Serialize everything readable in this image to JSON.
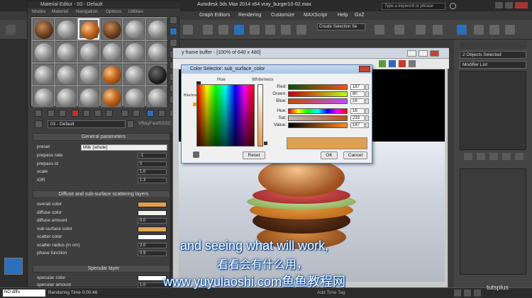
{
  "max": {
    "title": "Autodesk 3ds Max  2014 x64      vray_burger10-02.max",
    "search_placeholder": "Type a keyword or phrase",
    "menu": [
      "Graph Editors",
      "Rendering",
      "Customize",
      "MAXScript",
      "Help",
      "GoZ"
    ],
    "selection_set": "Create Selection Se"
  },
  "material_editor": {
    "title": "Material Editor - 03 - Default",
    "menu": [
      "Modes",
      "Material",
      "Navigation",
      "Options",
      "Utilities"
    ],
    "material_name": "03 - Default",
    "material_type": "VRayFastSSS2",
    "general": {
      "header": "General parameters",
      "preset_label": "preset",
      "preset_value": "Milk (whole)",
      "prepass_rate_label": "prepass rate",
      "prepass_rate": "-1",
      "prepass_id_label": "prepass id",
      "prepass_id": "0",
      "scale_label": "scale",
      "scale": "1.0",
      "ior_label": "IOR",
      "ior": "1.3"
    },
    "diffuse_sss": {
      "header": "Diffuse and sub-surface scattering layers",
      "overall_color_label": "overall color",
      "diffuse_color_label": "diffuse color",
      "diffuse_amount_label": "diffuse amount",
      "diffuse_amount": "0.0",
      "sub_surface_color_label": "sub-surface color",
      "scatter_color_label": "scatter color",
      "scatter_radius_label": "scatter radius (in cm)",
      "scatter_radius": "2.0",
      "phase_function_label": "phase function",
      "phase_function": "0.9"
    },
    "specular": {
      "header": "Specular layer",
      "specular_color_label": "specular color",
      "specular_amount_label": "specular amount",
      "specular_amount": "1.0"
    }
  },
  "vfb": {
    "title": "V-Ray frame buffer - [100% of 640 x 480]",
    "visible_title": "y frame buffer - [100% of 640 x 480]"
  },
  "color_selector": {
    "title": "Color Selector: sub_surface_color",
    "hue_label": "Hue",
    "whiteness_label": "Whiteness",
    "blackness_label": "Blackness",
    "rows": [
      {
        "label": "Red:",
        "value": "187"
      },
      {
        "label": "Green:",
        "value": "80"
      },
      {
        "label": "Blue:",
        "value": "16"
      },
      {
        "label": "Hue:",
        "value": "16"
      },
      {
        "label": "Sat:",
        "value": "233"
      },
      {
        "label": "Value:",
        "value": "187"
      }
    ],
    "reset_label": "Reset",
    "ok_label": "OK",
    "cancel_label": "Cancel"
  },
  "command_panel": {
    "selection": "2 Objects Selected",
    "modifier_list": "Modifier List"
  },
  "status": {
    "left": "NO diffu",
    "rendering_time": "Rendering Time  0:00:46",
    "add_time_tag": "Add Time Tag"
  },
  "subtitles": {
    "english": "and seeing what will work,",
    "chinese": "看看会有什么用，",
    "url": "www.yuyulaoshi.com鱼鱼教程网"
  },
  "watermark": "tutsplus",
  "colors": {
    "overall": "#e0a04f",
    "diffuse": "#f4f4ee",
    "sub_surface": "#e3a65d",
    "scatter": "#ffffff",
    "specular": "#ffffff"
  }
}
